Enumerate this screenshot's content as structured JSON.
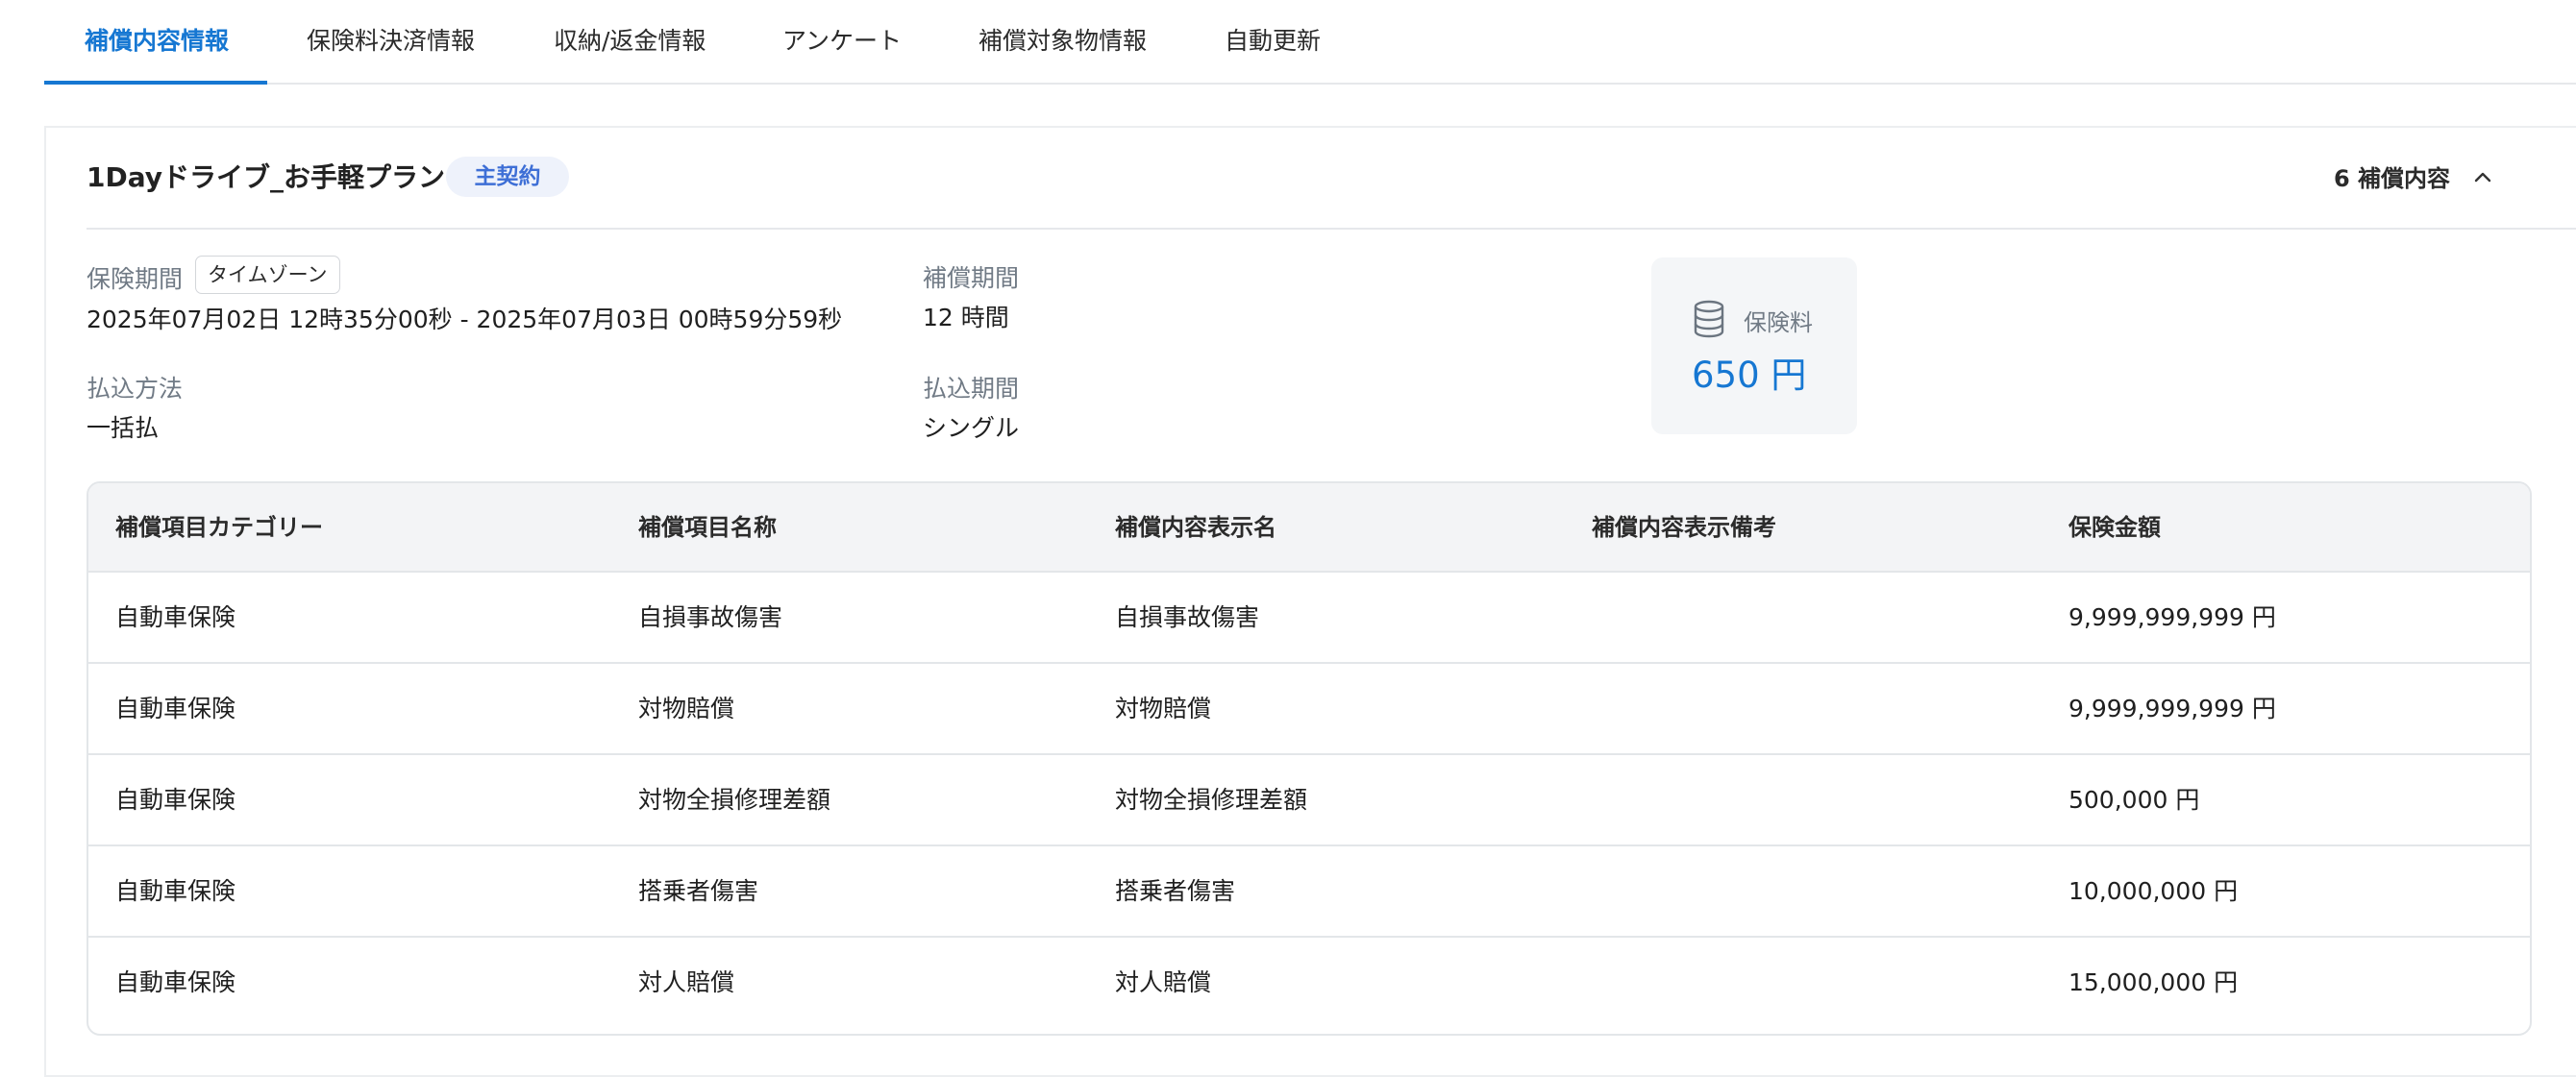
{
  "tabs": [
    {
      "label": "補償内容情報",
      "active": true
    },
    {
      "label": "保険料決済情報",
      "active": false
    },
    {
      "label": "収納/返金情報",
      "active": false
    },
    {
      "label": "アンケート",
      "active": false
    },
    {
      "label": "補償対象物情報",
      "active": false
    },
    {
      "label": "自動更新",
      "active": false
    }
  ],
  "plan": {
    "title": "1Dayドライブ_お手軽プラン",
    "badge": "主契約",
    "coverage_count": "6 補償内容",
    "collapse_icon": "chevron-up-icon"
  },
  "fields": {
    "insurance_period": {
      "label": "保険期間",
      "timezone_button": "タイムゾーン",
      "value": "2025年07月02日 12時35分00秒 - 2025年07月03日 00時59分59秒"
    },
    "coverage_period": {
      "label": "補償期間",
      "value": "12 時間"
    },
    "payment_method": {
      "label": "払込方法",
      "value": "一括払"
    },
    "payment_period": {
      "label": "払込期間",
      "value": "シングル"
    }
  },
  "premium": {
    "icon": "database-coins-icon",
    "label": "保険料",
    "value": "650 円",
    "color": "#1677d2"
  },
  "table": {
    "headers": [
      "補償項目カテゴリー",
      "補償項目名称",
      "補償内容表示名",
      "補償内容表示備考",
      "保険金額"
    ],
    "rows": [
      [
        "自動車保険",
        "自損事故傷害",
        "自損事故傷害",
        "",
        "9,999,999,999 円"
      ],
      [
        "自動車保険",
        "対物賠償",
        "対物賠償",
        "",
        "9,999,999,999 円"
      ],
      [
        "自動車保険",
        "対物全損修理差額",
        "対物全損修理差額",
        "",
        "500,000 円"
      ],
      [
        "自動車保険",
        "搭乗者傷害",
        "搭乗者傷害",
        "",
        "10,000,000 円"
      ],
      [
        "自動車保険",
        "対人賠償",
        "対人賠償",
        "",
        "15,000,000 円"
      ]
    ]
  }
}
